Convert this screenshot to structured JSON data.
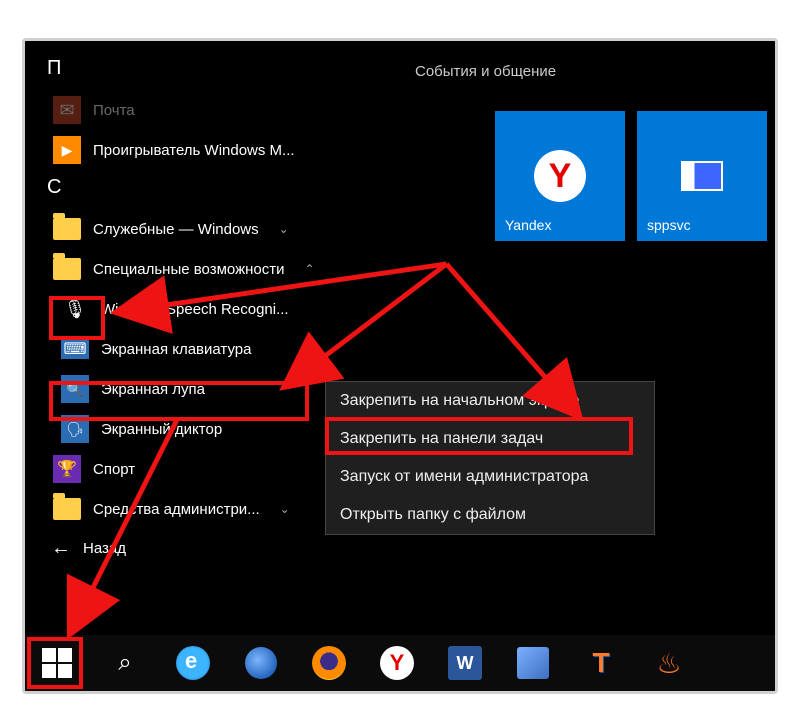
{
  "tiles_header": "События и общение",
  "letters": {
    "p": "П",
    "s": "С"
  },
  "apps": {
    "mail": "Почта",
    "wmp": "Проигрыватель Windows M...",
    "system": "Служебные — Windows",
    "ease": "Специальные возможности",
    "speech": "Windows Speech Recogni...",
    "onscreen_kbd": "Экранная клавиатура",
    "magnifier": "Экранная лупа",
    "narrator": "Экранный диктор",
    "sport": "Спорт",
    "admin_tools": "Средства администри..."
  },
  "back": "Назад",
  "tiles": {
    "yandex": "Yandex",
    "sppsvc": "sppsvc",
    "y_glyph": "Y"
  },
  "context_menu": {
    "pin_start": "Закрепить на начальном экране",
    "pin_taskbar": "Закрепить на панели задач",
    "run_admin": "Запуск от имени администратора",
    "open_folder": "Открыть папку с файлом"
  },
  "taskbar": {
    "word_glyph": "W",
    "tt_glyph": "T",
    "y_glyph": "Y"
  }
}
